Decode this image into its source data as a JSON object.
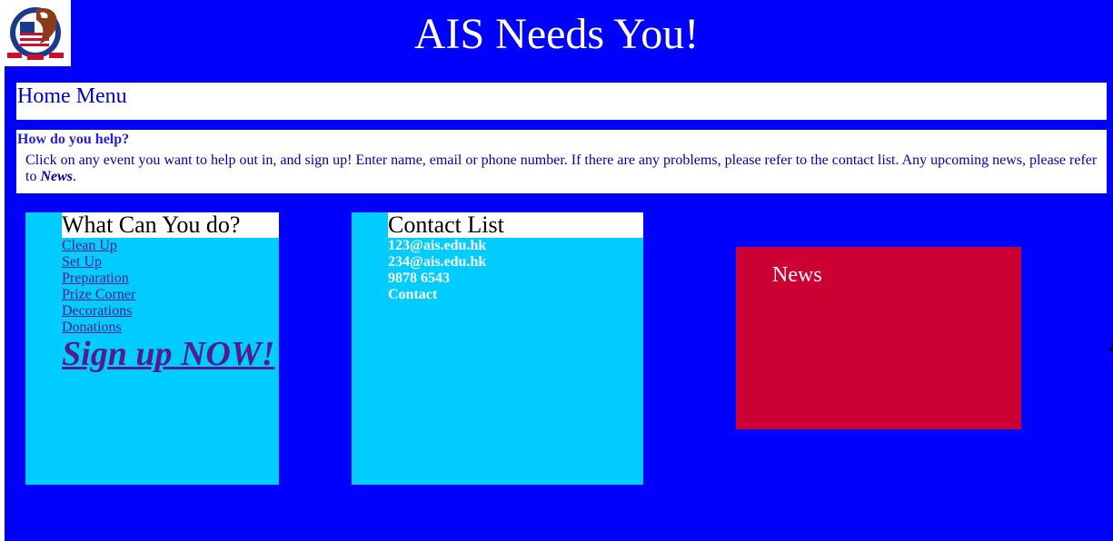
{
  "header": {
    "title": "AIS Needs You!",
    "logo_icon": "eagle-shield-logo-icon"
  },
  "nav": {
    "home_menu_label": "Home Menu"
  },
  "help": {
    "heading": "How do you help?",
    "text_prefix": "Click on any event you want to help out in, and sign up! Enter name, email or phone number. If there are any problems, please refer to the contact list. Any upcoming news, please refer to ",
    "news_word": "News",
    "text_suffix": "."
  },
  "what_can_you_do": {
    "heading": "What Can You do?",
    "links": [
      "Clean Up",
      "Set Up",
      "Preparation",
      "Prize Corner",
      "Decorations",
      "Donations"
    ],
    "signup_label": "Sign up NOW!"
  },
  "contact": {
    "heading": "Contact List",
    "items": [
      "123@ais.edu.hk",
      "234@ais.edu.hk",
      "9878 6543",
      "Contact"
    ]
  },
  "news": {
    "heading": "News"
  },
  "colors": {
    "page_background": "#0000ff",
    "panel_background": "#00ccff",
    "news_background": "#cc0033",
    "visited_link": "#551a8b"
  }
}
